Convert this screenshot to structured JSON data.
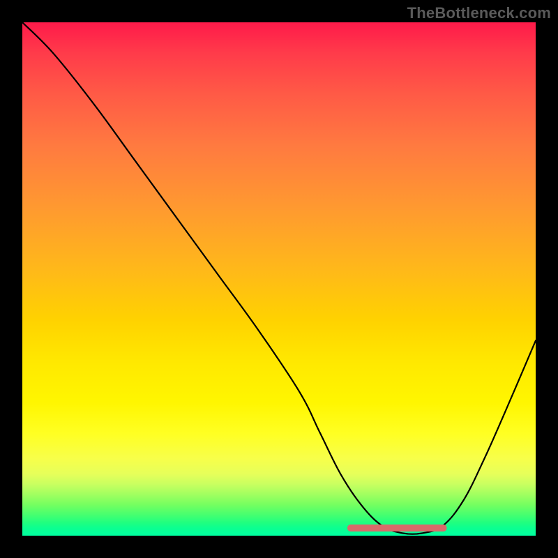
{
  "watermark": "TheBottleneck.com",
  "chart_data": {
    "type": "line",
    "title": "",
    "xlabel": "",
    "ylabel": "",
    "xlim": [
      0,
      100
    ],
    "ylim": [
      0,
      100
    ],
    "grid": false,
    "legend": false,
    "series": [
      {
        "name": "bottleneck-curve",
        "color": "#000000",
        "x": [
          0,
          6,
          14,
          22,
          30,
          38,
          46,
          54,
          58,
          62,
          66,
          70,
          74,
          78,
          82,
          86,
          90,
          94,
          100
        ],
        "y": [
          100,
          94,
          84,
          73,
          62,
          51,
          40,
          28,
          20,
          12,
          6,
          2,
          0.5,
          0.5,
          2,
          7,
          15,
          24,
          38
        ]
      }
    ],
    "highlight_segment": {
      "name": "optimal-range",
      "color": "#d96a6a",
      "x_start": 64,
      "x_end": 82,
      "y": 1.5
    }
  }
}
